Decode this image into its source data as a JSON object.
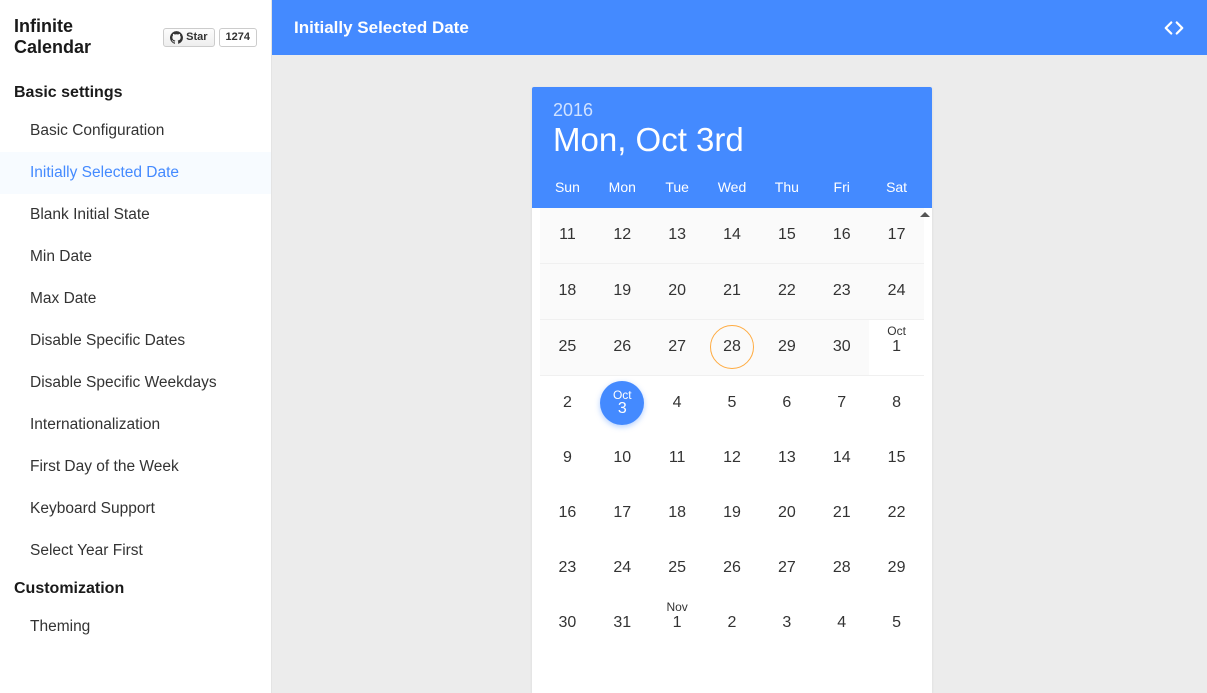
{
  "sidebar": {
    "title": "Infinite Calendar",
    "github": {
      "star_label": "Star",
      "star_count": "1274"
    },
    "sections": [
      {
        "title": "Basic settings",
        "items": [
          {
            "label": "Basic Configuration",
            "id": "basic-configuration"
          },
          {
            "label": "Initially Selected Date",
            "id": "initially-selected-date",
            "active": true
          },
          {
            "label": "Blank Initial State",
            "id": "blank-initial-state"
          },
          {
            "label": "Min Date",
            "id": "min-date"
          },
          {
            "label": "Max Date",
            "id": "max-date"
          },
          {
            "label": "Disable Specific Dates",
            "id": "disable-specific-dates"
          },
          {
            "label": "Disable Specific Weekdays",
            "id": "disable-specific-weekdays"
          },
          {
            "label": "Internationalization",
            "id": "internationalization"
          },
          {
            "label": "First Day of the Week",
            "id": "first-day-of-the-week"
          },
          {
            "label": "Keyboard Support",
            "id": "keyboard-support"
          },
          {
            "label": "Select Year First",
            "id": "select-year-first"
          }
        ]
      },
      {
        "title": "Customization",
        "items": [
          {
            "label": "Theming",
            "id": "theming"
          }
        ]
      }
    ]
  },
  "topbar": {
    "title": "Initially Selected Date"
  },
  "calendar": {
    "year": "2016",
    "date_label": "Mon, Oct 3rd",
    "weekdays": [
      "Sun",
      "Mon",
      "Tue",
      "Wed",
      "Thu",
      "Fri",
      "Sat"
    ],
    "rows": [
      {
        "shade": true,
        "cells": [
          {
            "n": "11"
          },
          {
            "n": "12"
          },
          {
            "n": "13"
          },
          {
            "n": "14"
          },
          {
            "n": "15"
          },
          {
            "n": "16"
          },
          {
            "n": "17"
          }
        ]
      },
      {
        "shade": true,
        "cells": [
          {
            "n": "18"
          },
          {
            "n": "19"
          },
          {
            "n": "20"
          },
          {
            "n": "21"
          },
          {
            "n": "22"
          },
          {
            "n": "23"
          },
          {
            "n": "24"
          }
        ]
      },
      {
        "shade": true,
        "cells": [
          {
            "n": "25"
          },
          {
            "n": "26"
          },
          {
            "n": "27"
          },
          {
            "n": "28",
            "today": true
          },
          {
            "n": "29"
          },
          {
            "n": "30"
          },
          {
            "n": "1",
            "monthLabel": "Oct",
            "monthStart": true
          }
        ]
      },
      {
        "cells": [
          {
            "n": "2"
          },
          {
            "n": "3",
            "selected": true,
            "selMonth": "Oct"
          },
          {
            "n": "4"
          },
          {
            "n": "5"
          },
          {
            "n": "6"
          },
          {
            "n": "7"
          },
          {
            "n": "8"
          }
        ]
      },
      {
        "cells": [
          {
            "n": "9"
          },
          {
            "n": "10"
          },
          {
            "n": "11"
          },
          {
            "n": "12"
          },
          {
            "n": "13"
          },
          {
            "n": "14"
          },
          {
            "n": "15"
          }
        ]
      },
      {
        "cells": [
          {
            "n": "16"
          },
          {
            "n": "17"
          },
          {
            "n": "18"
          },
          {
            "n": "19"
          },
          {
            "n": "20"
          },
          {
            "n": "21"
          },
          {
            "n": "22"
          }
        ]
      },
      {
        "cells": [
          {
            "n": "23"
          },
          {
            "n": "24"
          },
          {
            "n": "25"
          },
          {
            "n": "26"
          },
          {
            "n": "27"
          },
          {
            "n": "28"
          },
          {
            "n": "29"
          }
        ]
      },
      {
        "cells": [
          {
            "n": "30"
          },
          {
            "n": "31"
          },
          {
            "n": "1",
            "monthLabel": "Nov",
            "monthStart": true
          },
          {
            "n": "2"
          },
          {
            "n": "3"
          },
          {
            "n": "4"
          },
          {
            "n": "5"
          }
        ]
      }
    ]
  }
}
